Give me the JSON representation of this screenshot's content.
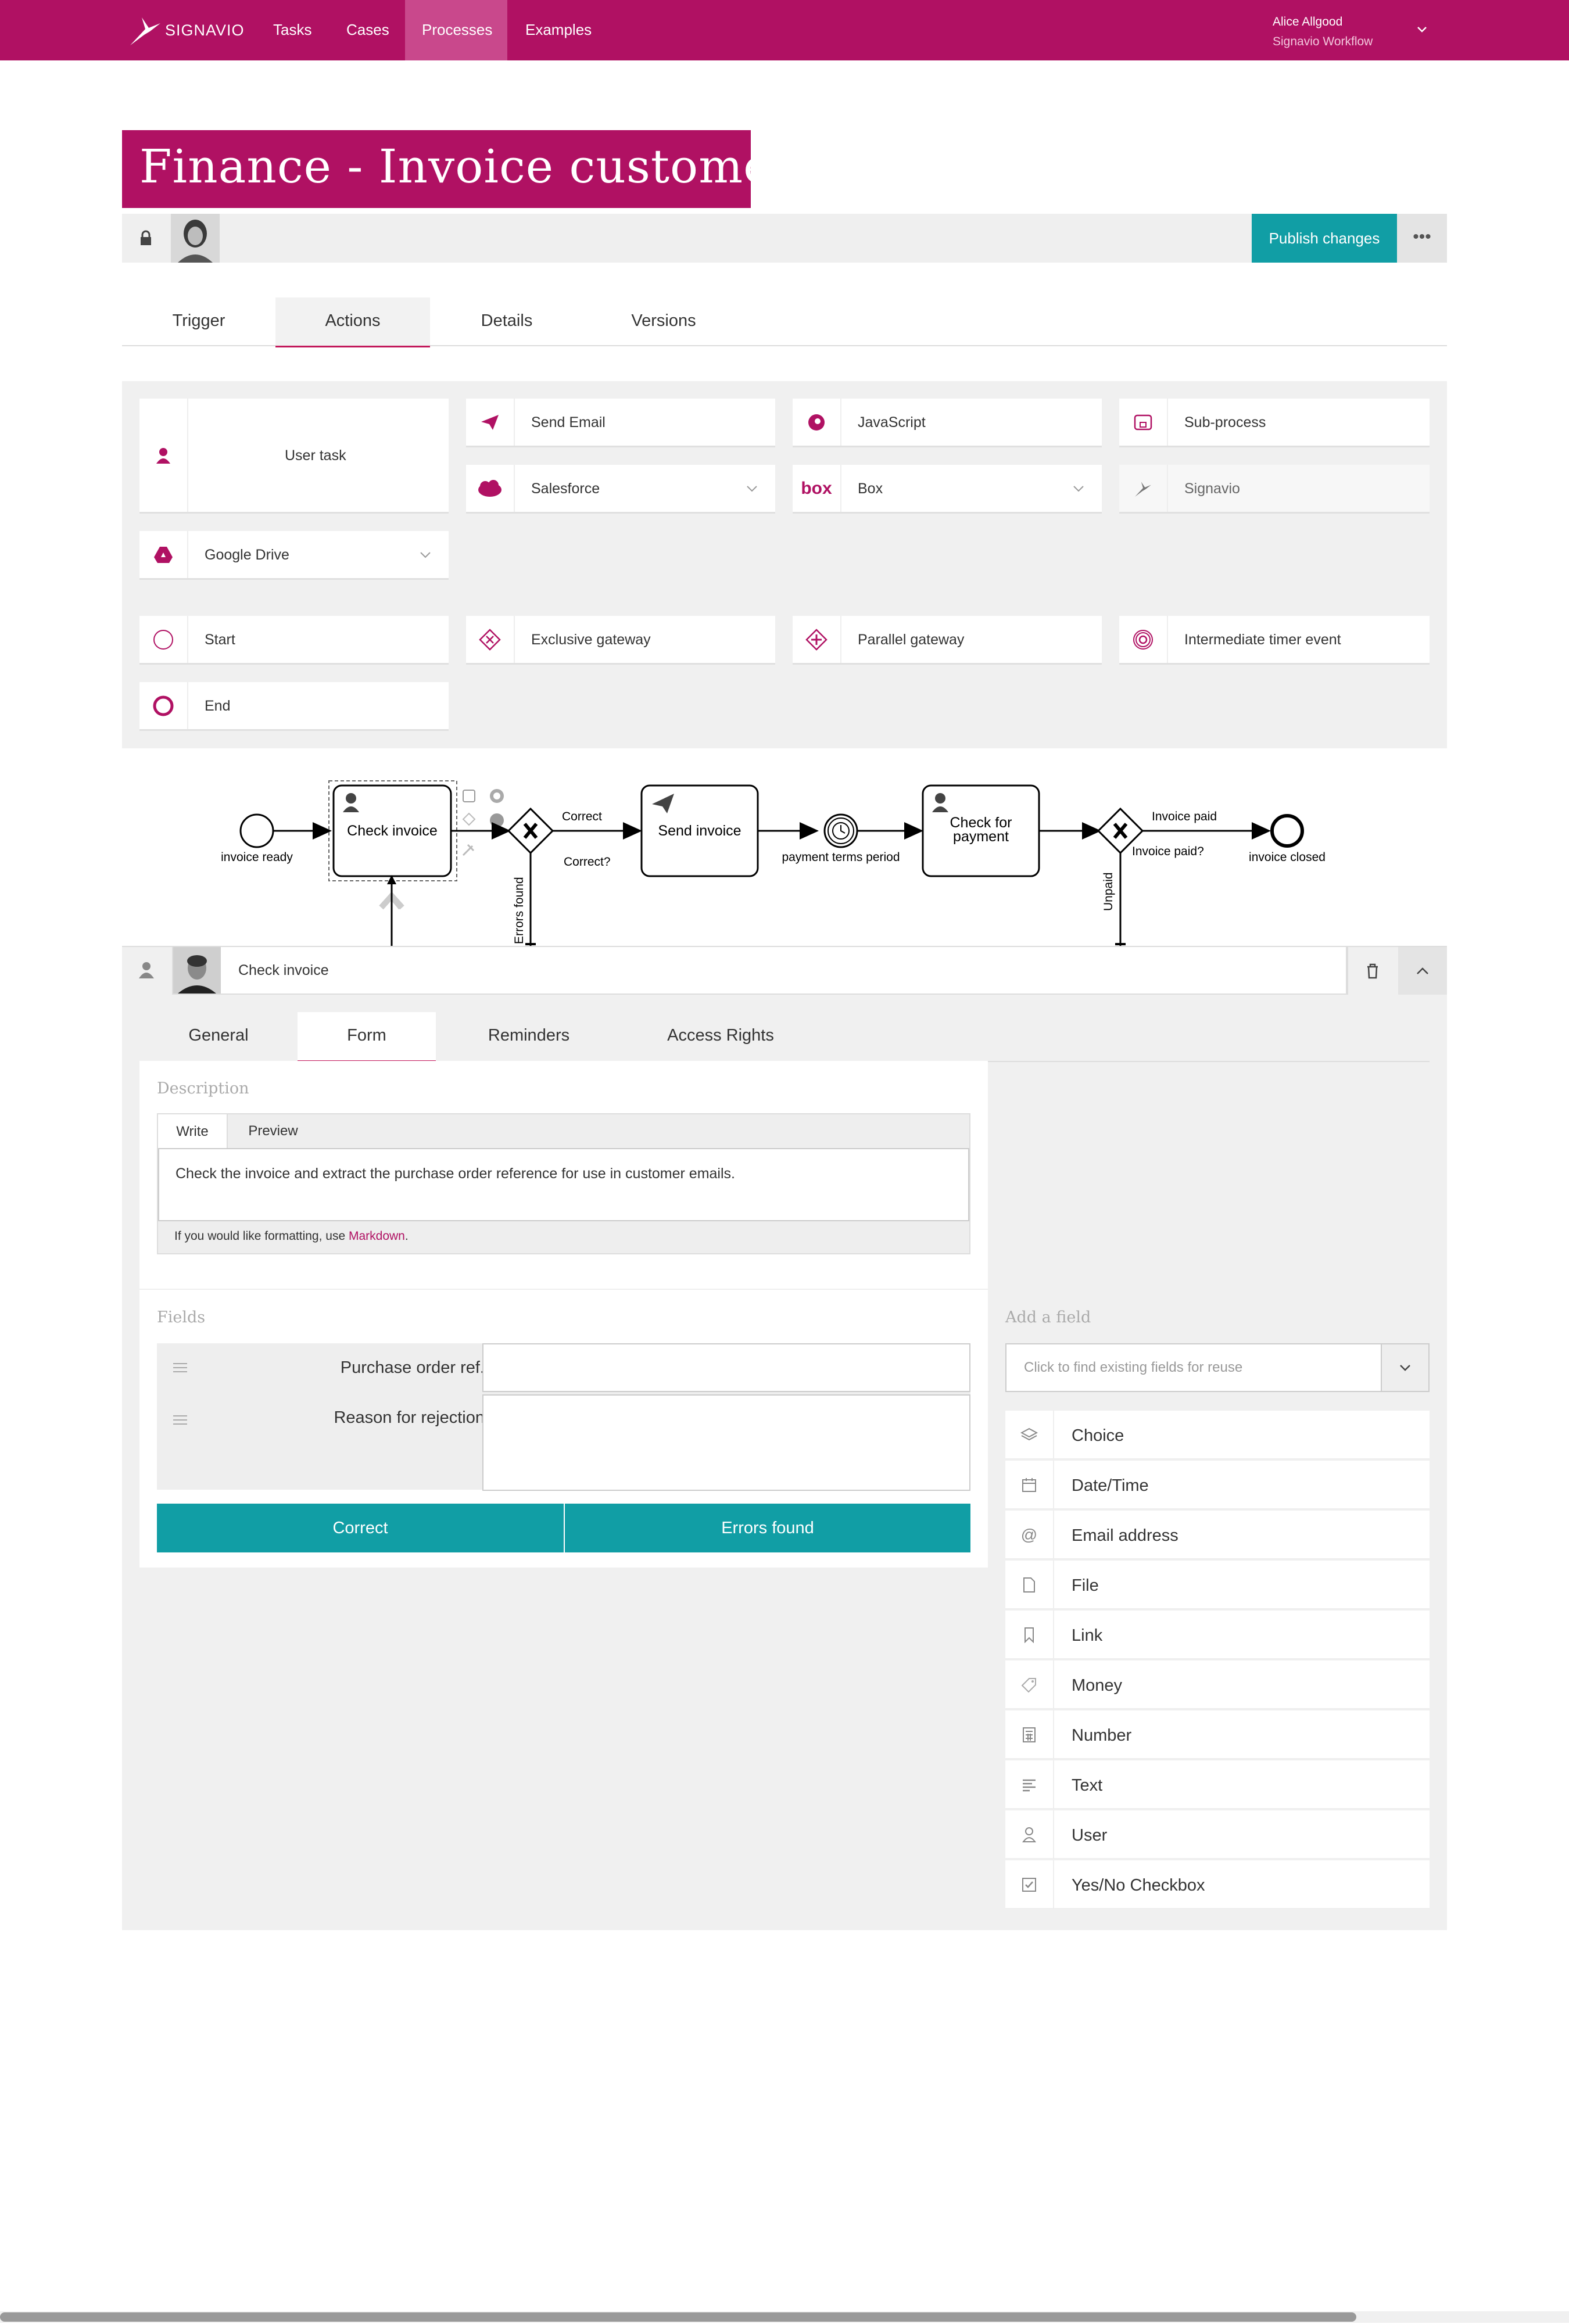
{
  "nav": {
    "brand": "SIGNAVIO",
    "items": [
      "Tasks",
      "Cases",
      "Processes",
      "Examples"
    ],
    "active": "Processes",
    "user_name": "Alice Allgood",
    "user_org": "Signavio Workflow"
  },
  "page": {
    "title": "Finance - Invoice customer",
    "publish": "Publish changes",
    "tabs": [
      "Trigger",
      "Actions",
      "Details",
      "Versions"
    ],
    "active_tab": "Actions"
  },
  "actions": {
    "user_task": "User task",
    "send_email": "Send Email",
    "javascript": "JavaScript",
    "sub_process": "Sub-process",
    "salesforce": "Salesforce",
    "box": "Box",
    "signavio": "Signavio",
    "google_drive": "Google Drive",
    "start": "Start",
    "exclusive_gateway": "Exclusive gateway",
    "parallel_gateway": "Parallel gateway",
    "timer_event": "Intermediate timer event",
    "end": "End"
  },
  "diagram": {
    "start_label": "invoice ready",
    "check_invoice": "Check invoice",
    "correct": "Correct",
    "correct_q": "Correct?",
    "errors_found": "Errors found",
    "send_invoice": "Send invoice",
    "timer_label": "payment terms period",
    "check_payment_1": "Check for",
    "check_payment_2": "payment",
    "invoice_paid": "Invoice paid",
    "invoice_paid_q": "Invoice paid?",
    "unpaid": "Unpaid",
    "end_label": "invoice closed"
  },
  "task": {
    "name": "Check invoice",
    "tabs": [
      "General",
      "Form",
      "Reminders",
      "Access Rights"
    ],
    "active_tab": "Form"
  },
  "form": {
    "description_heading": "Description",
    "write": "Write",
    "preview": "Preview",
    "description": "Check the invoice and extract the purchase order reference for use in customer emails.",
    "hint_prefix": "If you would like formatting, use ",
    "hint_link": "Markdown",
    "hint_suffix": ".",
    "fields_heading": "Fields",
    "fields": [
      {
        "label": "Purchase order ref."
      },
      {
        "label": "Reason for rejection"
      }
    ],
    "buttons": [
      "Correct",
      "Errors found"
    ]
  },
  "add_field": {
    "heading": "Add a field",
    "placeholder": "Click to find existing fields for reuse",
    "types": [
      {
        "label": "Choice",
        "icon": "layers-icon"
      },
      {
        "label": "Date/Time",
        "icon": "calendar-icon"
      },
      {
        "label": "Email address",
        "icon": "at-icon"
      },
      {
        "label": "File",
        "icon": "file-icon"
      },
      {
        "label": "Link",
        "icon": "bookmark-icon"
      },
      {
        "label": "Money",
        "icon": "tag-icon"
      },
      {
        "label": "Number",
        "icon": "calculator-icon"
      },
      {
        "label": "Text",
        "icon": "align-left-icon"
      },
      {
        "label": "User",
        "icon": "user-icon"
      },
      {
        "label": "Yes/No Checkbox",
        "icon": "checkbox-icon"
      }
    ]
  },
  "colors": {
    "brand": "#b01163",
    "teal": "#119ea5"
  }
}
